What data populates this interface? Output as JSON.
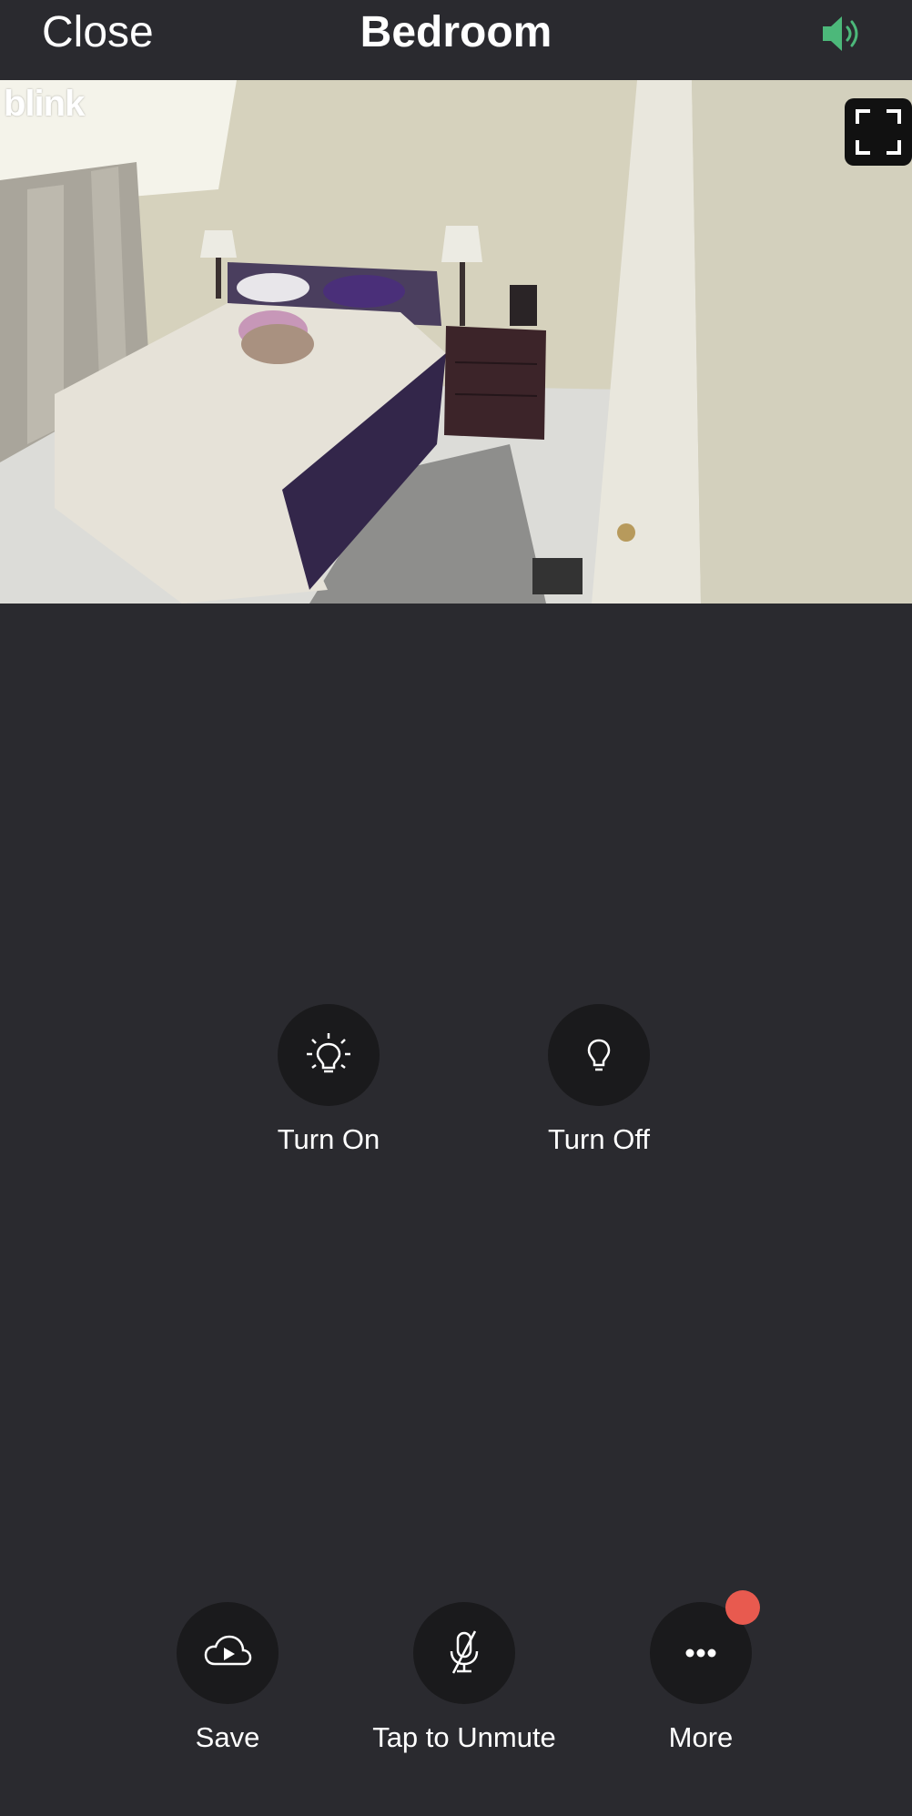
{
  "header": {
    "close_label": "Close",
    "title": "Bedroom",
    "speaker_icon": "speaker-on-icon",
    "speaker_color": "#4cb87a"
  },
  "feed": {
    "brand": "blink",
    "fullscreen_icon": "fullscreen-icon"
  },
  "light_controls": {
    "turn_on_label": "Turn On",
    "turn_off_label": "Turn Off"
  },
  "toolbar": {
    "save_label": "Save",
    "unmute_label": "Tap to Unmute",
    "more_label": "More",
    "badge_color": "#e85a4f"
  }
}
